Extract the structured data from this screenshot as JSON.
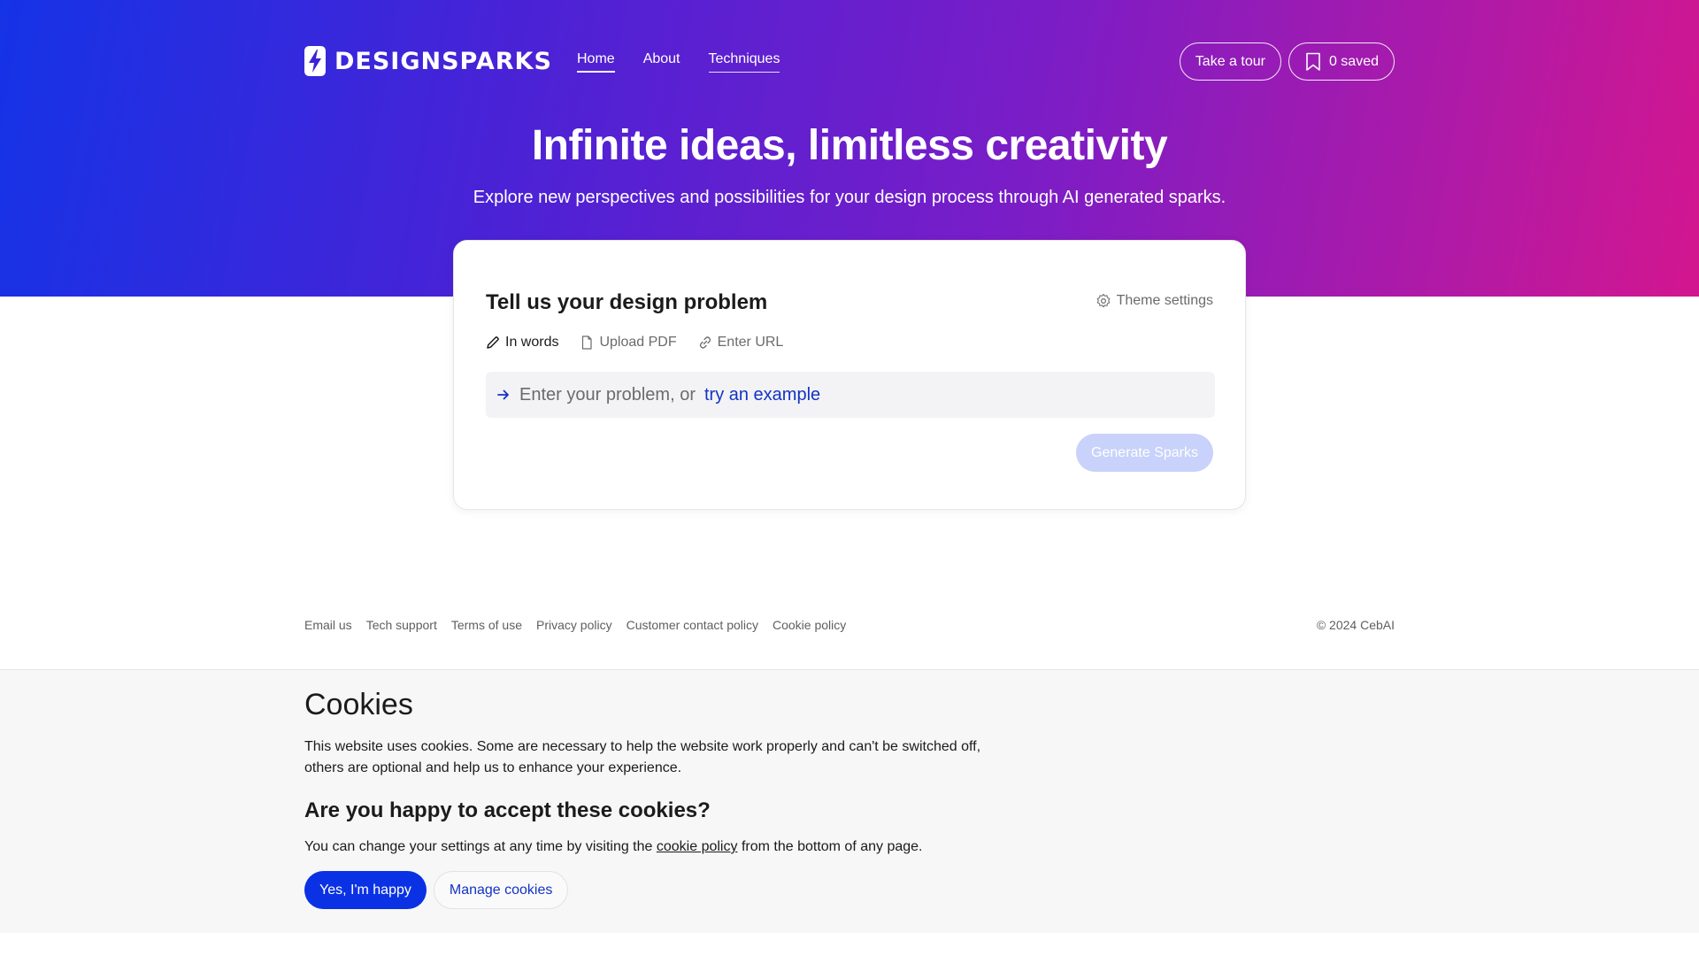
{
  "colors": {
    "hero_gradient_start": "#1533e6",
    "hero_gradient_end": "#d3168f",
    "primary_button": "#0a32e4",
    "link": "#1333c4",
    "generate_disabled": "#c8d2fb"
  },
  "header": {
    "logo_icon": "lightning-bolt-icon",
    "logo_text": "DESIGNSPARKS",
    "nav": [
      {
        "label": "Home",
        "active": true
      },
      {
        "label": "About",
        "active": false
      },
      {
        "label": "Techniques",
        "active": false
      }
    ],
    "tour_button": "Take a tour",
    "saved_icon": "bookmark-icon",
    "saved_button": "0 saved"
  },
  "hero": {
    "title": "Infinite ideas, limitless creativity",
    "subtitle": "Explore new perspectives and possibilities for your design process through AI generated sparks."
  },
  "card": {
    "title": "Tell us your design problem",
    "theme_settings_icon": "gear-icon",
    "theme_settings": "Theme settings",
    "tabs": [
      {
        "label": "In words",
        "icon": "pencil-icon",
        "active": true
      },
      {
        "label": "Upload PDF",
        "icon": "document-icon",
        "active": false
      },
      {
        "label": "Enter URL",
        "icon": "link-icon",
        "active": false
      }
    ],
    "input_icon": "arrow-right-icon",
    "input_placeholder": "Enter your problem, or",
    "input_example_link": "try an example",
    "generate_button": "Generate Sparks"
  },
  "footer": {
    "links": [
      "Email us",
      "Tech support",
      "Terms of use",
      "Privacy policy",
      "Customer contact policy",
      "Cookie policy"
    ],
    "copyright": "© 2024 CebAI"
  },
  "cookies": {
    "title": "Cookies",
    "text": "This website uses cookies. Some are necessary to help the website work properly and can't be switched off, others are optional and help us to enhance your experience.",
    "question": "Are you happy to accept these cookies?",
    "settings_prefix": "You can change your settings at any time by visiting the",
    "settings_link": "cookie policy",
    "settings_suffix": "from the bottom of any page.",
    "accept_button": "Yes, I'm happy",
    "manage_button": "Manage cookies"
  }
}
